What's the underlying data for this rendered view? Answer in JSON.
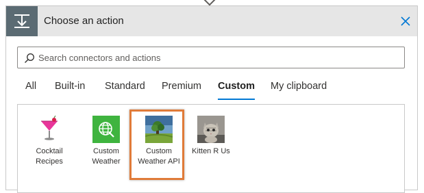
{
  "header": {
    "title": "Choose an action",
    "icon": "operation-icon",
    "close_icon": "close-icon"
  },
  "search": {
    "placeholder": "Search connectors and actions",
    "value": ""
  },
  "tabs": [
    {
      "label": "All",
      "active": false
    },
    {
      "label": "Built-in",
      "active": false
    },
    {
      "label": "Standard",
      "active": false
    },
    {
      "label": "Premium",
      "active": false
    },
    {
      "label": "Custom",
      "active": true
    },
    {
      "label": "My clipboard",
      "active": false
    }
  ],
  "connectors": [
    {
      "label": "Cocktail\nRecipes",
      "icon": "cocktail-glass-icon",
      "selected": false
    },
    {
      "label": "Custom\nWeather",
      "icon": "globe-icon",
      "selected": false
    },
    {
      "label": "Custom\nWeather API",
      "icon": "landscape-tree-icon",
      "selected": true
    },
    {
      "label": "Kitten R Us",
      "icon": "kitten-icon",
      "selected": false
    }
  ],
  "colors": {
    "accent": "#0078d4",
    "header_icon_bg": "#5b6b73",
    "selection_outline": "#e07b39",
    "custom_weather_tile": "#3fb43f"
  }
}
